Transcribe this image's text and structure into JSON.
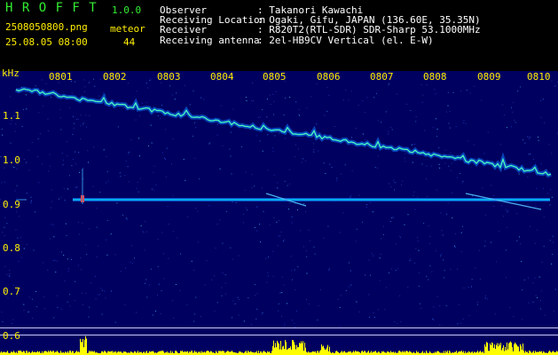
{
  "app": {
    "title": "H R O F F T",
    "version": "1.0.0"
  },
  "file": {
    "name": "2508050800.png",
    "datetime": "25.08.05 08:00"
  },
  "meteor": {
    "label": "meteor",
    "count": "44"
  },
  "info": {
    "observer_label": "Observer",
    "observer_value": ": Takanori Kawachi",
    "location_label": "Receiving Location",
    "location_value": ": Ogaki, Gifu, JAPAN (136.60E, 35.35N)",
    "receiver_label": "Receiver",
    "receiver_value": ": R820T2(RTL-SDR) SDR-Sharp 53.1000MHz",
    "antenna_label": "Receiving antenna",
    "antenna_value": ": 2el-HB9CV Vertical (el. E-W)"
  },
  "axis": {
    "y_unit": "kHz",
    "y_ticks": [
      "1.1",
      "1.0",
      "0.9",
      "0.8",
      "0.7",
      "0.6"
    ],
    "x_ticks": [
      "0801",
      "0802",
      "0803",
      "0804",
      "0805",
      "0806",
      "0807",
      "0808",
      "0809",
      "0810"
    ]
  },
  "colors": {
    "background": "#000060",
    "title_green": "#33ee33",
    "tick_yellow": "#ffee00",
    "bar_yellow": "#ffff00",
    "trace_cyan": "#00e5ff"
  }
}
